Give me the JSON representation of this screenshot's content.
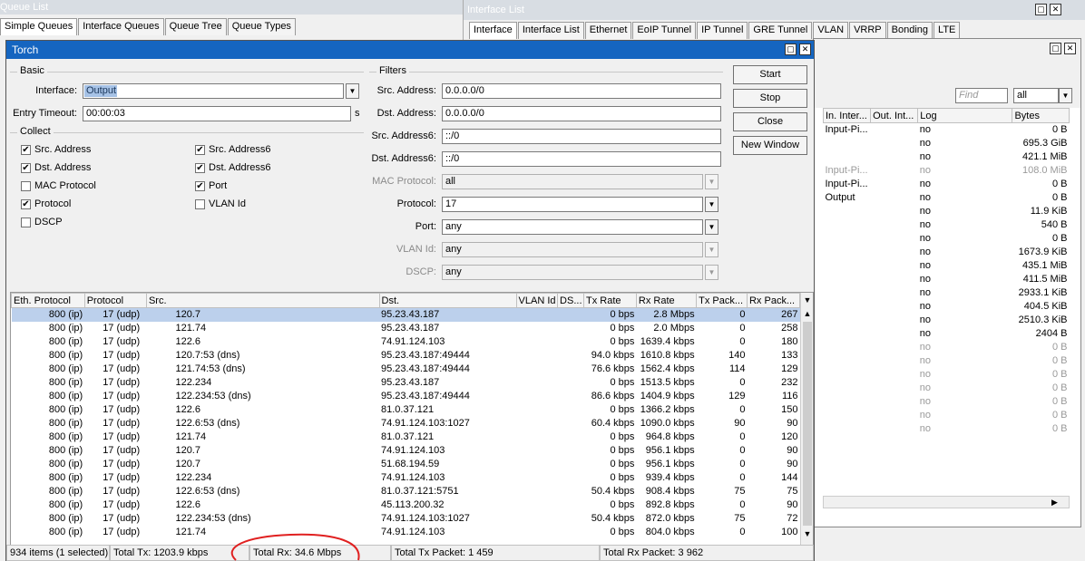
{
  "queue_list": {
    "title": "Queue List",
    "tabs": [
      "Simple Queues",
      "Interface Queues",
      "Queue Tree",
      "Queue Types"
    ]
  },
  "interface_list": {
    "title": "Interface List",
    "tabs": [
      "Interface",
      "Interface List",
      "Ethernet",
      "EoIP Tunnel",
      "IP Tunnel",
      "GRE Tunnel",
      "VLAN",
      "VRRP",
      "Bonding",
      "LTE"
    ],
    "find_placeholder": "Find",
    "filter_value": "all",
    "columns": [
      "In. Inter...",
      "Out. Int...",
      "Log",
      "Bytes"
    ],
    "rows": [
      {
        "in": "Input-Pi...",
        "out": "",
        "log": "no",
        "bytes": "0 B",
        "gray": false
      },
      {
        "in": "",
        "out": "",
        "log": "no",
        "bytes": "695.3 GiB",
        "gray": false
      },
      {
        "in": "",
        "out": "",
        "log": "no",
        "bytes": "421.1 MiB",
        "gray": false
      },
      {
        "in": "Input-Pi...",
        "out": "",
        "log": "no",
        "bytes": "108.0 MiB",
        "gray": true
      },
      {
        "in": "Input-Pi...",
        "out": "",
        "log": "no",
        "bytes": "0 B",
        "gray": false
      },
      {
        "in": "Output",
        "out": "",
        "log": "no",
        "bytes": "0 B",
        "gray": false
      },
      {
        "in": "",
        "out": "",
        "log": "no",
        "bytes": "11.9 KiB",
        "gray": false
      },
      {
        "in": "",
        "out": "",
        "log": "no",
        "bytes": "540 B",
        "gray": false
      },
      {
        "in": "",
        "out": "",
        "log": "no",
        "bytes": "0 B",
        "gray": false
      },
      {
        "in": "",
        "out": "",
        "log": "no",
        "bytes": "1673.9 KiB",
        "gray": false
      },
      {
        "in": "",
        "out": "",
        "log": "no",
        "bytes": "435.1 MiB",
        "gray": false
      },
      {
        "in": "",
        "out": "",
        "log": "no",
        "bytes": "411.5 MiB",
        "gray": false
      },
      {
        "in": "",
        "out": "",
        "log": "no",
        "bytes": "2933.1 KiB",
        "gray": false
      },
      {
        "in": "",
        "out": "",
        "log": "no",
        "bytes": "404.5 KiB",
        "gray": false
      },
      {
        "in": "",
        "out": "",
        "log": "no",
        "bytes": "2510.3 KiB",
        "gray": false
      },
      {
        "in": "",
        "out": "",
        "log": "no",
        "bytes": "2404 B",
        "gray": false
      },
      {
        "in": "",
        "out": "",
        "log": "no",
        "bytes": "0 B",
        "gray": true
      },
      {
        "in": "",
        "out": "",
        "log": "no",
        "bytes": "0 B",
        "gray": true
      },
      {
        "in": "",
        "out": "",
        "log": "no",
        "bytes": "0 B",
        "gray": true
      },
      {
        "in": "",
        "out": "",
        "log": "no",
        "bytes": "0 B",
        "gray": true
      },
      {
        "in": "",
        "out": "",
        "log": "no",
        "bytes": "0 B",
        "gray": true
      },
      {
        "in": "",
        "out": "",
        "log": "no",
        "bytes": "0 B",
        "gray": true
      },
      {
        "in": "",
        "out": "",
        "log": "no",
        "bytes": "0 B",
        "gray": true
      }
    ]
  },
  "torch": {
    "title": "Torch",
    "basic": {
      "legend": "Basic",
      "interface_label": "Interface:",
      "interface_value": "Output",
      "entry_timeout_label": "Entry Timeout:",
      "entry_timeout_value": "00:00:03",
      "entry_timeout_unit": "s"
    },
    "collect": {
      "legend": "Collect",
      "items": [
        {
          "label": "Src. Address",
          "checked": true
        },
        {
          "label": "Src. Address6",
          "checked": true
        },
        {
          "label": "Dst. Address",
          "checked": true
        },
        {
          "label": "Dst. Address6",
          "checked": true
        },
        {
          "label": "MAC Protocol",
          "checked": false
        },
        {
          "label": "Port",
          "checked": true
        },
        {
          "label": "Protocol",
          "checked": true
        },
        {
          "label": "VLAN Id",
          "checked": false
        },
        {
          "label": "DSCP",
          "checked": false
        }
      ]
    },
    "filters": {
      "legend": "Filters",
      "src_address_label": "Src. Address:",
      "src_address_value": "0.0.0.0/0",
      "dst_address_label": "Dst. Address:",
      "dst_address_value": "0.0.0.0/0",
      "src_address6_label": "Src. Address6:",
      "src_address6_value": "::/0",
      "dst_address6_label": "Dst. Address6:",
      "dst_address6_value": "::/0",
      "mac_protocol_label": "MAC Protocol:",
      "mac_protocol_value": "all",
      "protocol_label": "Protocol:",
      "protocol_value": "17",
      "port_label": "Port:",
      "port_value": "any",
      "vlan_id_label": "VLAN Id:",
      "vlan_id_value": "any",
      "dscp_label": "DSCP:",
      "dscp_value": "any"
    },
    "buttons": {
      "start": "Start",
      "stop": "Stop",
      "close": "Close",
      "new_window": "New Window"
    },
    "columns": [
      "Eth. Protocol",
      "Protocol",
      "Src.",
      "Dst.",
      "VLAN Id",
      "DS...",
      "Tx Rate",
      "Rx Rate",
      "Tx Pack...",
      "Rx Pack..."
    ],
    "rows": [
      {
        "eth": "800 (ip)",
        "proto": "17 (udp)",
        "src": "120.7",
        "dst": "95.23.43.187",
        "vlan": "",
        "ds": "",
        "tx": "0 bps",
        "rx": "2.8 Mbps",
        "txp": "0",
        "rxp": "267"
      },
      {
        "eth": "800 (ip)",
        "proto": "17 (udp)",
        "src": "121.74",
        "dst": "95.23.43.187",
        "vlan": "",
        "ds": "",
        "tx": "0 bps",
        "rx": "2.0 Mbps",
        "txp": "0",
        "rxp": "258"
      },
      {
        "eth": "800 (ip)",
        "proto": "17 (udp)",
        "src": "122.6",
        "dst": "74.91.124.103",
        "vlan": "",
        "ds": "",
        "tx": "0 bps",
        "rx": "1639.4 kbps",
        "txp": "0",
        "rxp": "180"
      },
      {
        "eth": "800 (ip)",
        "proto": "17 (udp)",
        "src": "120.7:53 (dns)",
        "dst": "95.23.43.187:49444",
        "vlan": "",
        "ds": "",
        "tx": "94.0 kbps",
        "rx": "1610.8 kbps",
        "txp": "140",
        "rxp": "133"
      },
      {
        "eth": "800 (ip)",
        "proto": "17 (udp)",
        "src": "121.74:53 (dns)",
        "dst": "95.23.43.187:49444",
        "vlan": "",
        "ds": "",
        "tx": "76.6 kbps",
        "rx": "1562.4 kbps",
        "txp": "114",
        "rxp": "129"
      },
      {
        "eth": "800 (ip)",
        "proto": "17 (udp)",
        "src": "122.234",
        "dst": "95.23.43.187",
        "vlan": "",
        "ds": "",
        "tx": "0 bps",
        "rx": "1513.5 kbps",
        "txp": "0",
        "rxp": "232"
      },
      {
        "eth": "800 (ip)",
        "proto": "17 (udp)",
        "src": "122.234:53 (dns)",
        "dst": "95.23.43.187:49444",
        "vlan": "",
        "ds": "",
        "tx": "86.6 kbps",
        "rx": "1404.9 kbps",
        "txp": "129",
        "rxp": "116"
      },
      {
        "eth": "800 (ip)",
        "proto": "17 (udp)",
        "src": "122.6",
        "dst": "81.0.37.121",
        "vlan": "",
        "ds": "",
        "tx": "0 bps",
        "rx": "1366.2 kbps",
        "txp": "0",
        "rxp": "150"
      },
      {
        "eth": "800 (ip)",
        "proto": "17 (udp)",
        "src": "122.6:53 (dns)",
        "dst": "74.91.124.103:1027",
        "vlan": "",
        "ds": "",
        "tx": "60.4 kbps",
        "rx": "1090.0 kbps",
        "txp": "90",
        "rxp": "90"
      },
      {
        "eth": "800 (ip)",
        "proto": "17 (udp)",
        "src": "121.74",
        "dst": "81.0.37.121",
        "vlan": "",
        "ds": "",
        "tx": "0 bps",
        "rx": "964.8 kbps",
        "txp": "0",
        "rxp": "120"
      },
      {
        "eth": "800 (ip)",
        "proto": "17 (udp)",
        "src": "120.7",
        "dst": "74.91.124.103",
        "vlan": "",
        "ds": "",
        "tx": "0 bps",
        "rx": "956.1 kbps",
        "txp": "0",
        "rxp": "90"
      },
      {
        "eth": "800 (ip)",
        "proto": "17 (udp)",
        "src": "120.7",
        "dst": "51.68.194.59",
        "vlan": "",
        "ds": "",
        "tx": "0 bps",
        "rx": "956.1 kbps",
        "txp": "0",
        "rxp": "90"
      },
      {
        "eth": "800 (ip)",
        "proto": "17 (udp)",
        "src": "122.234",
        "dst": "74.91.124.103",
        "vlan": "",
        "ds": "",
        "tx": "0 bps",
        "rx": "939.4 kbps",
        "txp": "0",
        "rxp": "144"
      },
      {
        "eth": "800 (ip)",
        "proto": "17 (udp)",
        "src": "122.6:53 (dns)",
        "dst": "81.0.37.121:5751",
        "vlan": "",
        "ds": "",
        "tx": "50.4 kbps",
        "rx": "908.4 kbps",
        "txp": "75",
        "rxp": "75"
      },
      {
        "eth": "800 (ip)",
        "proto": "17 (udp)",
        "src": "122.6",
        "dst": "45.113.200.32",
        "vlan": "",
        "ds": "",
        "tx": "0 bps",
        "rx": "892.8 kbps",
        "txp": "0",
        "rxp": "90"
      },
      {
        "eth": "800 (ip)",
        "proto": "17 (udp)",
        "src": "122.234:53 (dns)",
        "dst": "74.91.124.103:1027",
        "vlan": "",
        "ds": "",
        "tx": "50.4 kbps",
        "rx": "872.0 kbps",
        "txp": "75",
        "rxp": "72"
      },
      {
        "eth": "800 (ip)",
        "proto": "17 (udp)",
        "src": "121.74",
        "dst": "74.91.124.103",
        "vlan": "",
        "ds": "",
        "tx": "0 bps",
        "rx": "804.0 kbps",
        "txp": "0",
        "rxp": "100"
      }
    ],
    "status": {
      "items": "934 items (1 selected)",
      "total_tx": "Total Tx: 1203.9 kbps",
      "total_rx": "Total Rx: 34.6 Mbps",
      "total_tx_packet": "Total Tx Packet: 1 459",
      "total_rx_packet": "Total Rx Packet: 3 962"
    }
  }
}
